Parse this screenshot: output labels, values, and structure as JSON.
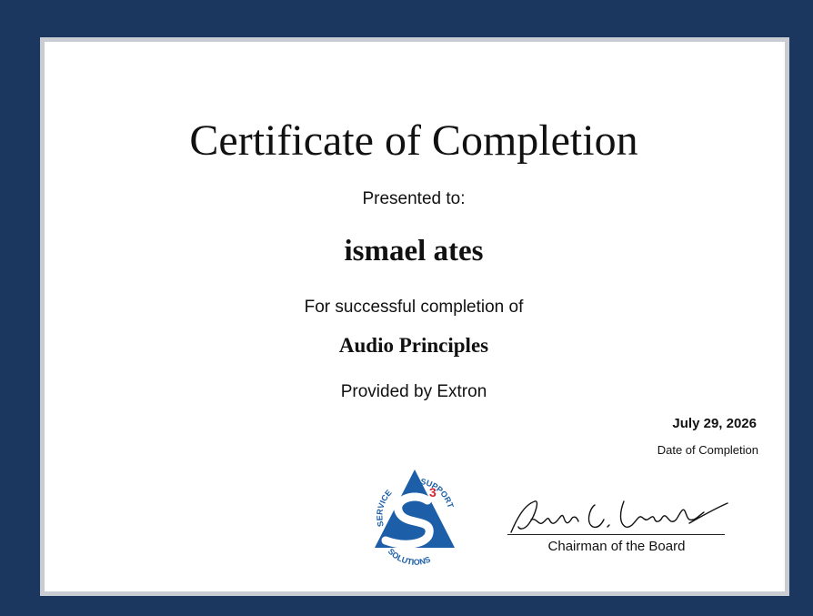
{
  "certificate": {
    "title": "Certificate of Completion",
    "presented_label": "Presented to:",
    "recipient": "ismael ates",
    "completion_label": "For successful completion of",
    "course": "Audio Principles",
    "provider": "Provided by Extron",
    "date": "July 29, 2026",
    "date_label": "Date of Completion",
    "signature_title": "Chairman of the Board"
  },
  "logo": {
    "icon": "s3-service-support-solutions-logo",
    "text_service": "SERVICE",
    "text_support": "SUPPORT",
    "text_solutions": "SOLUTIONS",
    "number": "3"
  },
  "colors": {
    "background": "#1b375f",
    "logo_blue": "#1c5fa8",
    "logo_red": "#d9232d"
  }
}
